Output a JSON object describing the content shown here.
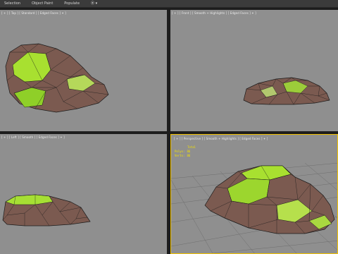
{
  "ribbon": {
    "tabs": [
      "Selection",
      "Object Paint",
      "Populate"
    ],
    "options_glyph": "⦿ ▾"
  },
  "viewports": {
    "top_left": {
      "label": "[ + ] [ Top ] [ Standard ] [ Edged Faces ] ✦ ]"
    },
    "top_right": {
      "label": "[ + ] [ Front ] [ Smooth + Highlights ] [ Edged Faces ] ✦ ]"
    },
    "bottom_left": {
      "label": "[ + ] [ Left ] [ Smooth ] [ Edged Faces ] ✦ ]"
    },
    "bottom_right": {
      "label": "[ + ] [ Perspective ] [ Smooth + Highlights ] [ Edged Faces ] ✦ ]"
    }
  },
  "stats": {
    "total_label": "Total",
    "polys_label": "Polys:",
    "polys_value": "86",
    "verts_label": "Verts:",
    "verts_value": "86"
  },
  "colors": {
    "viewport_bg": "#8f8f8f",
    "active_border": "#f2c200",
    "rock_brown": "#7b5a50",
    "moss_green": "#a8e030",
    "wire": "#1a1a1a",
    "stats_text": "#f5e200"
  }
}
